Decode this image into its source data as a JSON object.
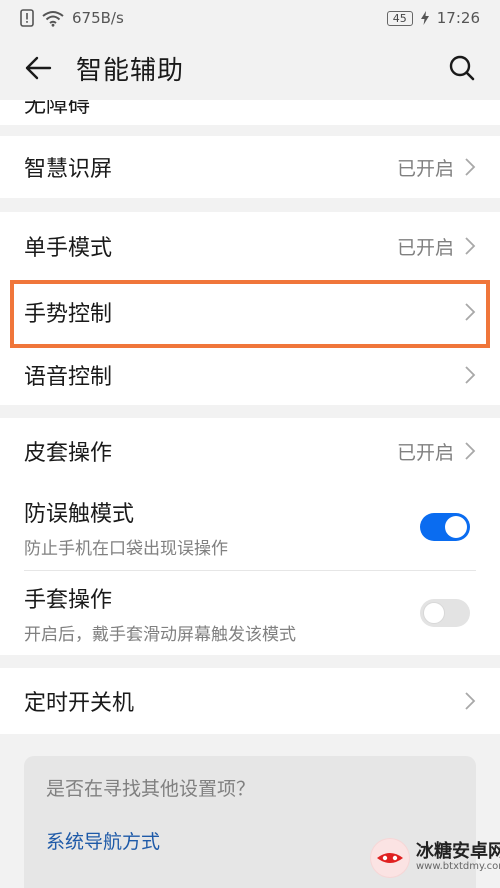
{
  "status_bar": {
    "network_speed": "675B/s",
    "battery_level": "45",
    "time": "17:26",
    "icons": [
      "sim-alert-icon",
      "wifi-icon",
      "battery-icon",
      "charging-icon"
    ]
  },
  "header": {
    "title": "智能辅助",
    "back_icon": "back-arrow-icon",
    "search_icon": "search-icon"
  },
  "peek_item": {
    "label": "无障碍"
  },
  "items": [
    {
      "label": "智慧识屏",
      "value": "已开启"
    },
    {
      "label": "单手模式",
      "value": "已开启"
    },
    {
      "label": "手势控制",
      "value": ""
    },
    {
      "label": "语音控制",
      "value": ""
    },
    {
      "label": "皮套操作",
      "value": "已开启"
    },
    {
      "label": "防误触模式",
      "subtitle": "防止手机在口袋出现误操作",
      "toggle": true
    },
    {
      "label": "手套操作",
      "subtitle": "开启后，戴手套滑动屏幕触发该模式",
      "toggle": false
    },
    {
      "label": "定时开关机",
      "value": ""
    }
  ],
  "highlight_color": "#f0763a",
  "accent_color": "#0a6cf0",
  "suggestion": {
    "question": "是否在寻找其他设置项？",
    "link": "系统导航方式"
  },
  "watermark": {
    "name": "冰糖安卓网",
    "url": "www.btxtdmy.com"
  }
}
